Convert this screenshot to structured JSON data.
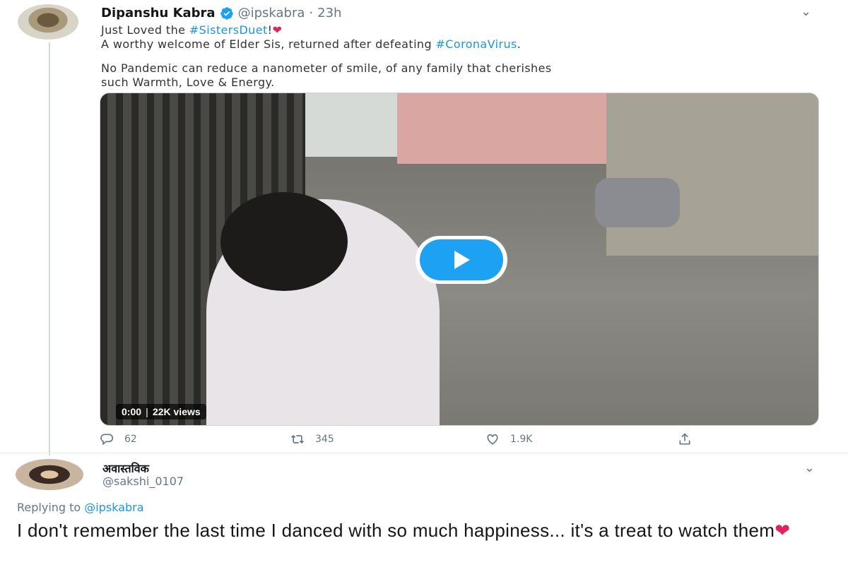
{
  "tweet": {
    "author_name": "Dipanshu Kabra",
    "handle": "@ipskabra",
    "separator": "·",
    "time": "23h",
    "line1_prefix": "Just Loved the ",
    "line1_hashtag": "#SistersDuet",
    "line1_suffix": "!",
    "line2_prefix": "A worthy welcome of Elder Sis, returned after defeating ",
    "line2_hashtag": "#CoronaVirus",
    "line2_suffix": ".",
    "line3": "No Pandemic can reduce a nanometer of smile, of any family that cherishes",
    "line4": "such Warmth, Love & Energy.",
    "video": {
      "time": "0:00",
      "views": "22K views"
    },
    "actions": {
      "replies": "62",
      "retweets": "345",
      "likes": "1.9K"
    }
  },
  "reply": {
    "author_name": "अवास्तविक",
    "handle": "@sakshi_0107",
    "replying_to_label": "Replying to",
    "replying_to_handle": "@ipskabra",
    "text": "I don't remember the last time I danced with so much happiness... it's a treat to watch them"
  },
  "colors": {
    "link": "#1b95e0",
    "heart": "#e0245e",
    "play_button": "#1da1f2",
    "muted": "#657786"
  }
}
